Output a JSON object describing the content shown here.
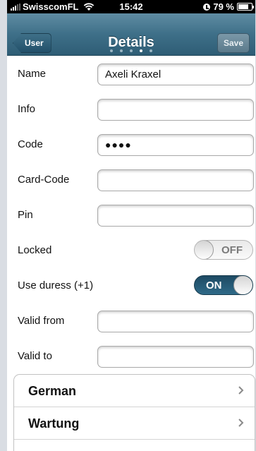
{
  "status_bar": {
    "carrier": "SwisscomFL",
    "time": "15:42",
    "battery": "79 %",
    "battery_level": 0.79
  },
  "navbar": {
    "back_label": "User",
    "title": "Details",
    "save_label": "Save",
    "page_count": 5,
    "active_page": 4
  },
  "form": {
    "name_label": "Name",
    "name_value": "Axeli Kraxel",
    "info_label": "Info",
    "info_value": "",
    "code_label": "Code",
    "code_value": "●●●●",
    "card_code_label": "Card-Code",
    "card_code_value": "",
    "pin_label": "Pin",
    "pin_value": "",
    "locked_label": "Locked",
    "locked_state": "OFF",
    "duress_label": "Use duress (+1)",
    "duress_state": "ON",
    "valid_from_label": "Valid from",
    "valid_from_value": "",
    "valid_to_label": "Valid to",
    "valid_to_value": ""
  },
  "menu": {
    "items": [
      {
        "label": "German"
      },
      {
        "label": "Wartung"
      }
    ]
  },
  "colors": {
    "navbar": "#3e6f88",
    "toggle_on": "#2f6a88"
  }
}
